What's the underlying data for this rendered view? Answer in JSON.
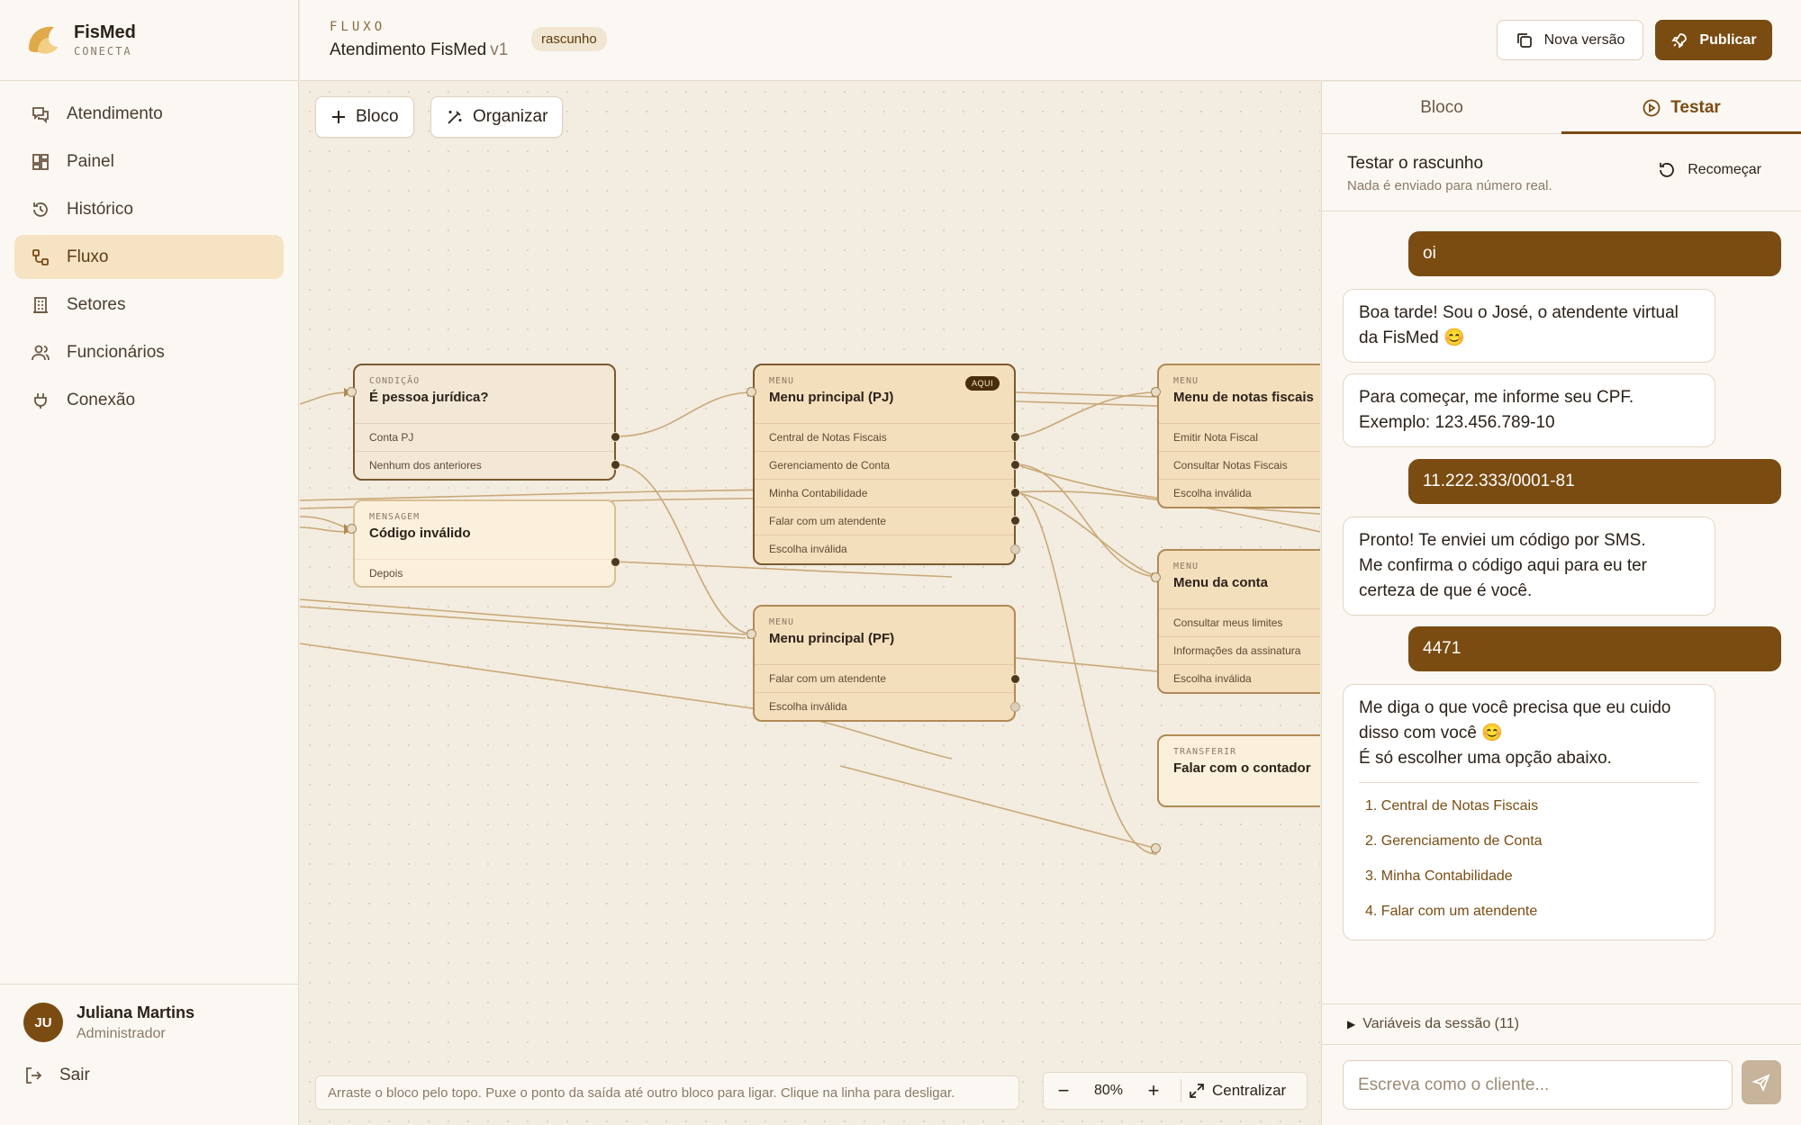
{
  "brand": {
    "name": "FisMed",
    "sub": "CONECTA"
  },
  "nav": [
    {
      "label": "Atendimento",
      "icon": "chat-icon"
    },
    {
      "label": "Painel",
      "icon": "dashboard-icon"
    },
    {
      "label": "Histórico",
      "icon": "history-icon"
    },
    {
      "label": "Fluxo",
      "icon": "flow-icon",
      "active": true
    },
    {
      "label": "Setores",
      "icon": "building-icon"
    },
    {
      "label": "Funcionários",
      "icon": "users-icon"
    },
    {
      "label": "Conexão",
      "icon": "plug-icon"
    }
  ],
  "user": {
    "initials": "JU",
    "name": "Juliana Martins",
    "role": "Administrador",
    "logout": "Sair"
  },
  "header": {
    "kicker": "FLUXO",
    "title": "Atendimento FisMed",
    "version": "v1",
    "badge": "rascunho",
    "new_version": "Nova versão",
    "publish": "Publicar"
  },
  "toolbar": {
    "add_block": "Bloco",
    "organize": "Organizar"
  },
  "nodes": {
    "cond_pj": {
      "kind": "CONDIÇÃO",
      "title": "É pessoa jurídica?",
      "outputs": [
        "Conta PJ",
        "Nenhum dos anteriores"
      ]
    },
    "msg_invalid": {
      "kind": "MENSAGEM",
      "title": "Código inválido",
      "outputs": [
        "Depois"
      ]
    },
    "menu_pj": {
      "kind": "MENU",
      "title": "Menu principal (PJ)",
      "badge": "AQUI",
      "outputs": [
        "Central de Notas Fiscais",
        "Gerenciamento de Conta",
        "Minha Contabilidade",
        "Falar com um atendente",
        "Escolha inválida"
      ]
    },
    "menu_pf": {
      "kind": "MENU",
      "title": "Menu principal (PF)",
      "outputs": [
        "Falar com um atendente",
        "Escolha inválida"
      ]
    },
    "menu_nf": {
      "kind": "MENU",
      "title": "Menu de notas fiscais",
      "outputs": [
        "Emitir Nota Fiscal",
        "Consultar Notas Fiscais",
        "Escolha inválida"
      ]
    },
    "menu_conta": {
      "kind": "MENU",
      "title": "Menu da conta",
      "outputs": [
        "Consultar meus limites",
        "Informações da assinatura",
        "Escolha inválida"
      ]
    },
    "transfer": {
      "kind": "TRANSFERIR",
      "title": "Falar com o contador"
    }
  },
  "canvas": {
    "hint": "Arraste o bloco pelo topo. Puxe o ponto da saída até outro bloco para ligar. Clique na linha para desligar.",
    "zoom": "80%",
    "center": "Centralizar"
  },
  "panel": {
    "tabs": [
      {
        "label": "Bloco"
      },
      {
        "label": "Testar",
        "active": true
      }
    ],
    "test_title": "Testar o rascunho",
    "test_sub": "Nada é enviado para número real.",
    "restart": "Recomeçar",
    "messages": [
      {
        "from": "user",
        "text": "oi"
      },
      {
        "from": "bot",
        "text": "Boa tarde! Sou o José, o atendente virtual da FisMed 😊"
      },
      {
        "from": "bot",
        "text": "Para começar, me informe seu CPF.\nExemplo: 123.456.789-10"
      },
      {
        "from": "user",
        "text": "11.222.333/0001-81"
      },
      {
        "from": "bot",
        "text": "Pronto! Te enviei um código por SMS.\nMe confirma o código aqui para eu ter certeza de que é você."
      },
      {
        "from": "user",
        "text": "4471"
      },
      {
        "from": "bot",
        "text": "Me diga o que você precisa que eu cuido disso com você 😊\nÉ só escolher uma opção abaixo.",
        "options": [
          "1. Central de Notas Fiscais",
          "2. Gerenciamento de Conta",
          "3. Minha Contabilidade",
          "4. Falar com um atendente"
        ]
      }
    ],
    "vars": "Variáveis da sessão (11)",
    "input_placeholder": "Escreva como o cliente..."
  },
  "colors": {
    "accent": "#7a4c12",
    "canvas": "#f3ece0",
    "node": "#f4dfbd",
    "edge": "#c9a978"
  }
}
